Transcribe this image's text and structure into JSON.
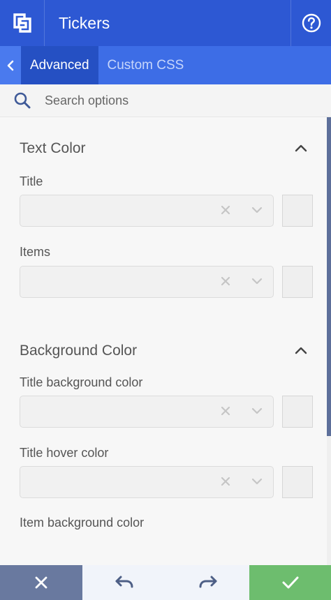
{
  "header": {
    "title": "Tickers",
    "logo_icon": "builder-logo-icon",
    "help_icon": "help-circle-icon"
  },
  "tabs": [
    {
      "label": "Advanced",
      "active": true
    },
    {
      "label": "Custom CSS",
      "active": false
    }
  ],
  "search": {
    "placeholder": "Search options",
    "value": ""
  },
  "sections": [
    {
      "title": "Text Color",
      "expanded": true,
      "fields": [
        {
          "label": "Title",
          "value": ""
        },
        {
          "label": "Items",
          "value": ""
        }
      ]
    },
    {
      "title": "Background Color",
      "expanded": true,
      "fields": [
        {
          "label": "Title background color",
          "value": ""
        },
        {
          "label": "Title hover color",
          "value": ""
        },
        {
          "label": "Item background color",
          "value": ""
        }
      ]
    }
  ],
  "footer": {
    "cancel_icon": "close-icon",
    "undo_icon": "undo-icon",
    "redo_icon": "redo-icon",
    "save_icon": "checkmark-icon"
  },
  "colors": {
    "header": "#2d58d3",
    "tabs": "#3d6de6",
    "active_tab": "#2550c3",
    "cancel": "#69799f",
    "save": "#6dbd6e"
  }
}
